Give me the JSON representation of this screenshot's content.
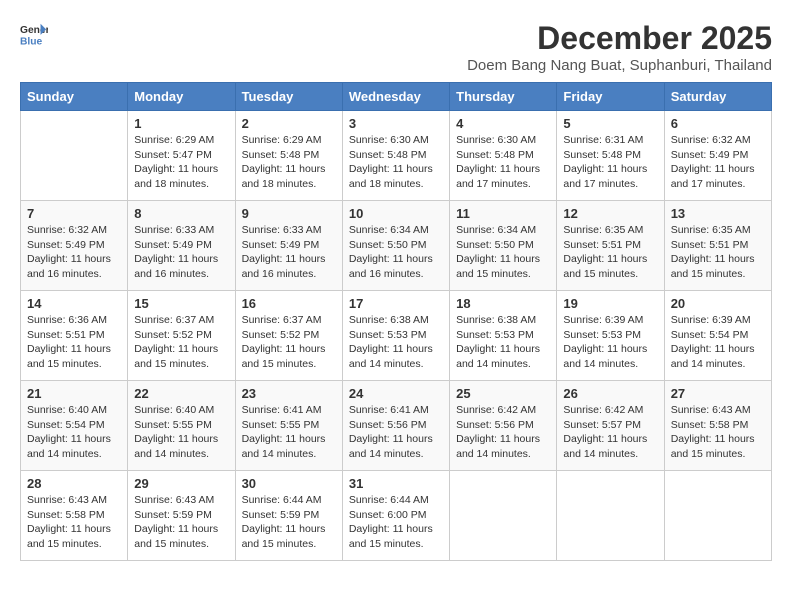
{
  "logo": {
    "general": "General",
    "blue": "Blue"
  },
  "title": "December 2025",
  "location": "Doem Bang Nang Buat, Suphanburi, Thailand",
  "days_of_week": [
    "Sunday",
    "Monday",
    "Tuesday",
    "Wednesday",
    "Thursday",
    "Friday",
    "Saturday"
  ],
  "weeks": [
    [
      {
        "day": "",
        "sunrise": "",
        "sunset": "",
        "daylight": ""
      },
      {
        "day": "1",
        "sunrise": "Sunrise: 6:29 AM",
        "sunset": "Sunset: 5:47 PM",
        "daylight": "Daylight: 11 hours and 18 minutes."
      },
      {
        "day": "2",
        "sunrise": "Sunrise: 6:29 AM",
        "sunset": "Sunset: 5:48 PM",
        "daylight": "Daylight: 11 hours and 18 minutes."
      },
      {
        "day": "3",
        "sunrise": "Sunrise: 6:30 AM",
        "sunset": "Sunset: 5:48 PM",
        "daylight": "Daylight: 11 hours and 18 minutes."
      },
      {
        "day": "4",
        "sunrise": "Sunrise: 6:30 AM",
        "sunset": "Sunset: 5:48 PM",
        "daylight": "Daylight: 11 hours and 17 minutes."
      },
      {
        "day": "5",
        "sunrise": "Sunrise: 6:31 AM",
        "sunset": "Sunset: 5:48 PM",
        "daylight": "Daylight: 11 hours and 17 minutes."
      },
      {
        "day": "6",
        "sunrise": "Sunrise: 6:32 AM",
        "sunset": "Sunset: 5:49 PM",
        "daylight": "Daylight: 11 hours and 17 minutes."
      }
    ],
    [
      {
        "day": "7",
        "sunrise": "Sunrise: 6:32 AM",
        "sunset": "Sunset: 5:49 PM",
        "daylight": "Daylight: 11 hours and 16 minutes."
      },
      {
        "day": "8",
        "sunrise": "Sunrise: 6:33 AM",
        "sunset": "Sunset: 5:49 PM",
        "daylight": "Daylight: 11 hours and 16 minutes."
      },
      {
        "day": "9",
        "sunrise": "Sunrise: 6:33 AM",
        "sunset": "Sunset: 5:49 PM",
        "daylight": "Daylight: 11 hours and 16 minutes."
      },
      {
        "day": "10",
        "sunrise": "Sunrise: 6:34 AM",
        "sunset": "Sunset: 5:50 PM",
        "daylight": "Daylight: 11 hours and 16 minutes."
      },
      {
        "day": "11",
        "sunrise": "Sunrise: 6:34 AM",
        "sunset": "Sunset: 5:50 PM",
        "daylight": "Daylight: 11 hours and 15 minutes."
      },
      {
        "day": "12",
        "sunrise": "Sunrise: 6:35 AM",
        "sunset": "Sunset: 5:51 PM",
        "daylight": "Daylight: 11 hours and 15 minutes."
      },
      {
        "day": "13",
        "sunrise": "Sunrise: 6:35 AM",
        "sunset": "Sunset: 5:51 PM",
        "daylight": "Daylight: 11 hours and 15 minutes."
      }
    ],
    [
      {
        "day": "14",
        "sunrise": "Sunrise: 6:36 AM",
        "sunset": "Sunset: 5:51 PM",
        "daylight": "Daylight: 11 hours and 15 minutes."
      },
      {
        "day": "15",
        "sunrise": "Sunrise: 6:37 AM",
        "sunset": "Sunset: 5:52 PM",
        "daylight": "Daylight: 11 hours and 15 minutes."
      },
      {
        "day": "16",
        "sunrise": "Sunrise: 6:37 AM",
        "sunset": "Sunset: 5:52 PM",
        "daylight": "Daylight: 11 hours and 15 minutes."
      },
      {
        "day": "17",
        "sunrise": "Sunrise: 6:38 AM",
        "sunset": "Sunset: 5:53 PM",
        "daylight": "Daylight: 11 hours and 14 minutes."
      },
      {
        "day": "18",
        "sunrise": "Sunrise: 6:38 AM",
        "sunset": "Sunset: 5:53 PM",
        "daylight": "Daylight: 11 hours and 14 minutes."
      },
      {
        "day": "19",
        "sunrise": "Sunrise: 6:39 AM",
        "sunset": "Sunset: 5:53 PM",
        "daylight": "Daylight: 11 hours and 14 minutes."
      },
      {
        "day": "20",
        "sunrise": "Sunrise: 6:39 AM",
        "sunset": "Sunset: 5:54 PM",
        "daylight": "Daylight: 11 hours and 14 minutes."
      }
    ],
    [
      {
        "day": "21",
        "sunrise": "Sunrise: 6:40 AM",
        "sunset": "Sunset: 5:54 PM",
        "daylight": "Daylight: 11 hours and 14 minutes."
      },
      {
        "day": "22",
        "sunrise": "Sunrise: 6:40 AM",
        "sunset": "Sunset: 5:55 PM",
        "daylight": "Daylight: 11 hours and 14 minutes."
      },
      {
        "day": "23",
        "sunrise": "Sunrise: 6:41 AM",
        "sunset": "Sunset: 5:55 PM",
        "daylight": "Daylight: 11 hours and 14 minutes."
      },
      {
        "day": "24",
        "sunrise": "Sunrise: 6:41 AM",
        "sunset": "Sunset: 5:56 PM",
        "daylight": "Daylight: 11 hours and 14 minutes."
      },
      {
        "day": "25",
        "sunrise": "Sunrise: 6:42 AM",
        "sunset": "Sunset: 5:56 PM",
        "daylight": "Daylight: 11 hours and 14 minutes."
      },
      {
        "day": "26",
        "sunrise": "Sunrise: 6:42 AM",
        "sunset": "Sunset: 5:57 PM",
        "daylight": "Daylight: 11 hours and 14 minutes."
      },
      {
        "day": "27",
        "sunrise": "Sunrise: 6:43 AM",
        "sunset": "Sunset: 5:58 PM",
        "daylight": "Daylight: 11 hours and 15 minutes."
      }
    ],
    [
      {
        "day": "28",
        "sunrise": "Sunrise: 6:43 AM",
        "sunset": "Sunset: 5:58 PM",
        "daylight": "Daylight: 11 hours and 15 minutes."
      },
      {
        "day": "29",
        "sunrise": "Sunrise: 6:43 AM",
        "sunset": "Sunset: 5:59 PM",
        "daylight": "Daylight: 11 hours and 15 minutes."
      },
      {
        "day": "30",
        "sunrise": "Sunrise: 6:44 AM",
        "sunset": "Sunset: 5:59 PM",
        "daylight": "Daylight: 11 hours and 15 minutes."
      },
      {
        "day": "31",
        "sunrise": "Sunrise: 6:44 AM",
        "sunset": "Sunset: 6:00 PM",
        "daylight": "Daylight: 11 hours and 15 minutes."
      },
      {
        "day": "",
        "sunrise": "",
        "sunset": "",
        "daylight": ""
      },
      {
        "day": "",
        "sunrise": "",
        "sunset": "",
        "daylight": ""
      },
      {
        "day": "",
        "sunrise": "",
        "sunset": "",
        "daylight": ""
      }
    ]
  ]
}
